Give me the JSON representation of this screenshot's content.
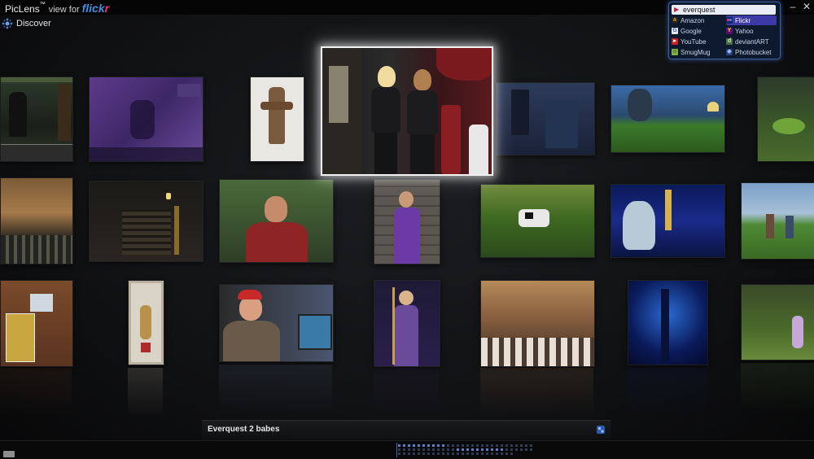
{
  "app": {
    "name": "PicLens",
    "trademark": "™",
    "view_for": "view for",
    "brand_main": "flick",
    "brand_accent": "r",
    "minimize_glyph": "–",
    "close_glyph": "✕"
  },
  "discover": {
    "label": "Discover",
    "icon": "discover-icon"
  },
  "search": {
    "query": "everquest",
    "providers": [
      {
        "label": "Amazon",
        "icon": "amazon-icon",
        "selected": false
      },
      {
        "label": "Flickr",
        "icon": "flickr-icon",
        "selected": true
      },
      {
        "label": "Google",
        "icon": "google-icon",
        "selected": false
      },
      {
        "label": "Yahoo",
        "icon": "yahoo-icon",
        "selected": false
      },
      {
        "label": "YouTube",
        "icon": "youtube-icon",
        "selected": false
      },
      {
        "label": "deviantART",
        "icon": "deviantart-icon",
        "selected": false
      },
      {
        "label": "SmugMug",
        "icon": "smugmug-icon",
        "selected": false
      },
      {
        "label": "Photobucket",
        "icon": "photobucket-icon",
        "selected": false
      }
    ]
  },
  "caption": {
    "text": "Everquest 2 babes",
    "icon": "info-icon"
  },
  "colors": {
    "accent_blue": "#3d8fe0",
    "accent_pink": "#ff2a8a",
    "selected_provider": "#3d3aa8",
    "panel_border": "#3a5f9a"
  },
  "thumbnails": [
    {
      "id": "game-hud-screenshot"
    },
    {
      "id": "purple-game-screenshot"
    },
    {
      "id": "dragon-figure-art"
    },
    {
      "id": "two-costumed-women"
    },
    {
      "id": "blue-night-street"
    },
    {
      "id": "fantasy-landscape-mushrooms"
    },
    {
      "id": "green-swamp-scene"
    },
    {
      "id": "audience-in-hall"
    },
    {
      "id": "dark-staircase"
    },
    {
      "id": "red-armor-character"
    },
    {
      "id": "costumed-woman-stone-wall"
    },
    {
      "id": "cow-in-field"
    },
    {
      "id": "blue-glowing-tree"
    },
    {
      "id": "characters-in-meadow"
    },
    {
      "id": "game-boxes-on-table"
    },
    {
      "id": "framed-emblem-art"
    },
    {
      "id": "man-red-cap"
    },
    {
      "id": "purple-sorceress"
    },
    {
      "id": "conference-chairs"
    },
    {
      "id": "blue-forest-night"
    },
    {
      "id": "fairy-in-forest"
    }
  ]
}
